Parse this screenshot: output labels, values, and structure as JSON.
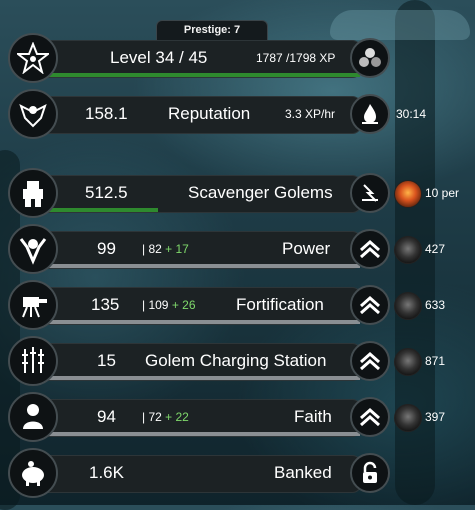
{
  "prestige": "Prestige: 7",
  "level": {
    "label": "Level 34 / 45",
    "xp": "1787 /1798 XP",
    "progress": 0.99
  },
  "reputation": {
    "value": "158.1",
    "label": "Reputation",
    "rate": "3.3 XP/hr",
    "timer": "30:14"
  },
  "golems": {
    "value": "512.5",
    "label": "Scavenger Golems",
    "per": "10 per",
    "progress": 0.35
  },
  "stats": [
    {
      "value": "99",
      "base": "| 82",
      "bonus": "+ 17",
      "label": "Power",
      "cost": "427",
      "icon": "raised-fists-icon"
    },
    {
      "value": "135",
      "base": "| 109",
      "bonus": "+ 26",
      "label": "Fortification",
      "cost": "633",
      "icon": "turret-icon"
    },
    {
      "value": "15",
      "base": "",
      "bonus": "",
      "label": "Golem Charging Station",
      "cost": "871",
      "icon": "lightning-rods-icon"
    },
    {
      "value": "94",
      "base": "| 72",
      "bonus": "+ 22",
      "label": "Faith",
      "cost": "397",
      "icon": "praying-figure-icon"
    }
  ],
  "banked": {
    "value": "1.6K",
    "label": "Banked"
  },
  "colors": {
    "xp_bar": "#2e8a2e",
    "stat_bar": "#8a8f93"
  }
}
